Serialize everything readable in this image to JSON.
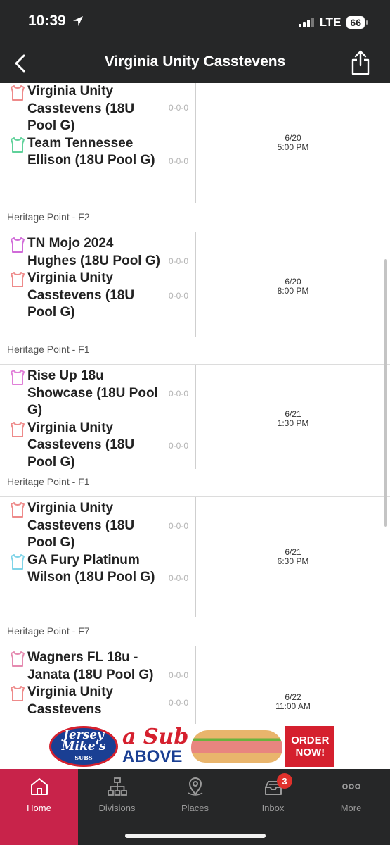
{
  "status_bar": {
    "time": "10:39",
    "network": "LTE",
    "battery": "66"
  },
  "nav": {
    "title": "Virginia Unity Casstevens"
  },
  "games": [
    {
      "teams": [
        {
          "name": "Virginia Unity Casstevens (18U Pool G)",
          "record": "0-0-0",
          "color": "#ee8a8a"
        },
        {
          "name": "Team Tennessee Ellison (18U Pool G)",
          "record": "0-0-0",
          "color": "#5fd19a"
        }
      ],
      "date": "6/20",
      "time": "5:00 PM",
      "venue": "Heritage Point - F2"
    },
    {
      "teams": [
        {
          "name": "TN Mojo 2024 Hughes (18U Pool G)",
          "record": "0-0-0",
          "color": "#d06ad8"
        },
        {
          "name": "Virginia Unity Casstevens (18U Pool G)",
          "record": "0-0-0",
          "color": "#ee8a8a"
        }
      ],
      "date": "6/20",
      "time": "8:00 PM",
      "venue": "Heritage Point - F1"
    },
    {
      "teams": [
        {
          "name": "Rise Up 18u Showcase (18U Pool G)",
          "record": "0-0-0",
          "color": "#e07fd8"
        },
        {
          "name": "Virginia Unity Casstevens (18U Pool G)",
          "record": "0-0-0",
          "color": "#ee8a8a"
        }
      ],
      "date": "6/21",
      "time": "1:30 PM",
      "venue": "Heritage Point - F1"
    },
    {
      "teams": [
        {
          "name": "Virginia Unity Casstevens (18U Pool G)",
          "record": "0-0-0",
          "color": "#ee8a8a"
        },
        {
          "name": "GA Fury Platinum Wilson (18U Pool G)",
          "record": "0-0-0",
          "color": "#7fd4e8"
        }
      ],
      "date": "6/21",
      "time": "6:30 PM",
      "venue": "Heritage Point - F7"
    },
    {
      "teams": [
        {
          "name": "Wagners FL 18u - Janata (18U Pool G)",
          "record": "0-0-0",
          "color": "#e58ab0"
        },
        {
          "name": "Virginia Unity Casstevens",
          "record": "0-0-0",
          "color": "#ee8a8a"
        }
      ],
      "date": "6/22",
      "time": "11:00 AM",
      "venue": ""
    }
  ],
  "ad": {
    "brand_line1": "Jersey",
    "brand_line2": "Mike's",
    "brand_sub": "SUBS",
    "slogan_1": "a Sub",
    "slogan_2": "ABOVE",
    "order_1": "ORDER",
    "order_2": "NOW!"
  },
  "tabs": [
    {
      "label": "Home",
      "icon": "home-icon",
      "active": true
    },
    {
      "label": "Divisions",
      "icon": "divisions-icon",
      "active": false
    },
    {
      "label": "Places",
      "icon": "map-pin-icon",
      "active": false
    },
    {
      "label": "Inbox",
      "icon": "inbox-icon",
      "active": false,
      "badge": "3"
    },
    {
      "label": "More",
      "icon": "more-icon",
      "active": false
    }
  ],
  "colors": {
    "header_bg": "#262728",
    "active_tab": "#c8234a",
    "badge": "#e0312c"
  }
}
